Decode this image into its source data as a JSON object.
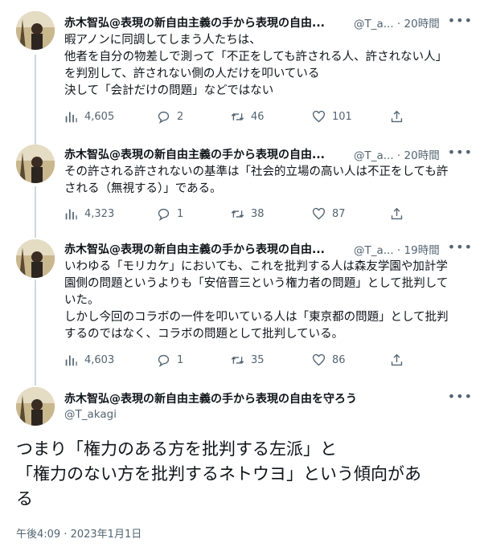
{
  "tweets": [
    {
      "name": "赤木智弘@表現の新自由主義の手から表現の自由...",
      "handle_time": "@T_a... · 20時間",
      "lines": [
        "暇アノンに同調してしまう人たちは、",
        "他者を自分の物差しで測って「不正をしても許される人、許されない人」",
        "を判別して、許されない側の人だけを叩いている",
        "決して「会計だけの問題」などではない"
      ],
      "views": "4,605",
      "replies": "2",
      "retweets": "46",
      "likes": "101"
    },
    {
      "name": "赤木智弘@表現の新自由主義の手から表現の自由...",
      "handle_time": "@T_a... · 20時間",
      "lines": [
        "その許される許されないの基準は「社会的立場の高い人は不正をしても許",
        "される（無視する）」である。"
      ],
      "views": "4,323",
      "replies": "1",
      "retweets": "38",
      "likes": "87"
    },
    {
      "name": "赤木智弘@表現の新自由主義の手から表現の自由...",
      "handle_time": "@T_a... · 19時間",
      "lines": [
        "いわゆる「モリカケ」においても、これを批判する人は森友学園や加計学",
        "園側の問題というよりも「安倍晋三という権力者の問題」として批判して",
        "いた。",
        "しかし今回のコラボの一件を叩いている人は「東京都の問題」として批判",
        "するのではなく、コラボの問題として批判している。"
      ],
      "views": "4,603",
      "replies": "1",
      "retweets": "35",
      "likes": "86"
    }
  ],
  "main_tweet": {
    "name": "赤木智弘@表現の新自由主義の手から表現の自由を守ろう",
    "handle": "@T_akagi",
    "lines": [
      "つまり「権力のある方を批判する左派」と",
      "「権力のない方を批判するネトウヨ」という傾向があ",
      "る"
    ],
    "timestamp": "午後4:09 · 2023年1月1日"
  },
  "icons": {
    "views": "bar-chart-icon",
    "reply": "reply-bubble-icon",
    "retweet": "retweet-icon",
    "like": "heart-icon",
    "share": "share-icon",
    "more": "more-dots-icon"
  }
}
